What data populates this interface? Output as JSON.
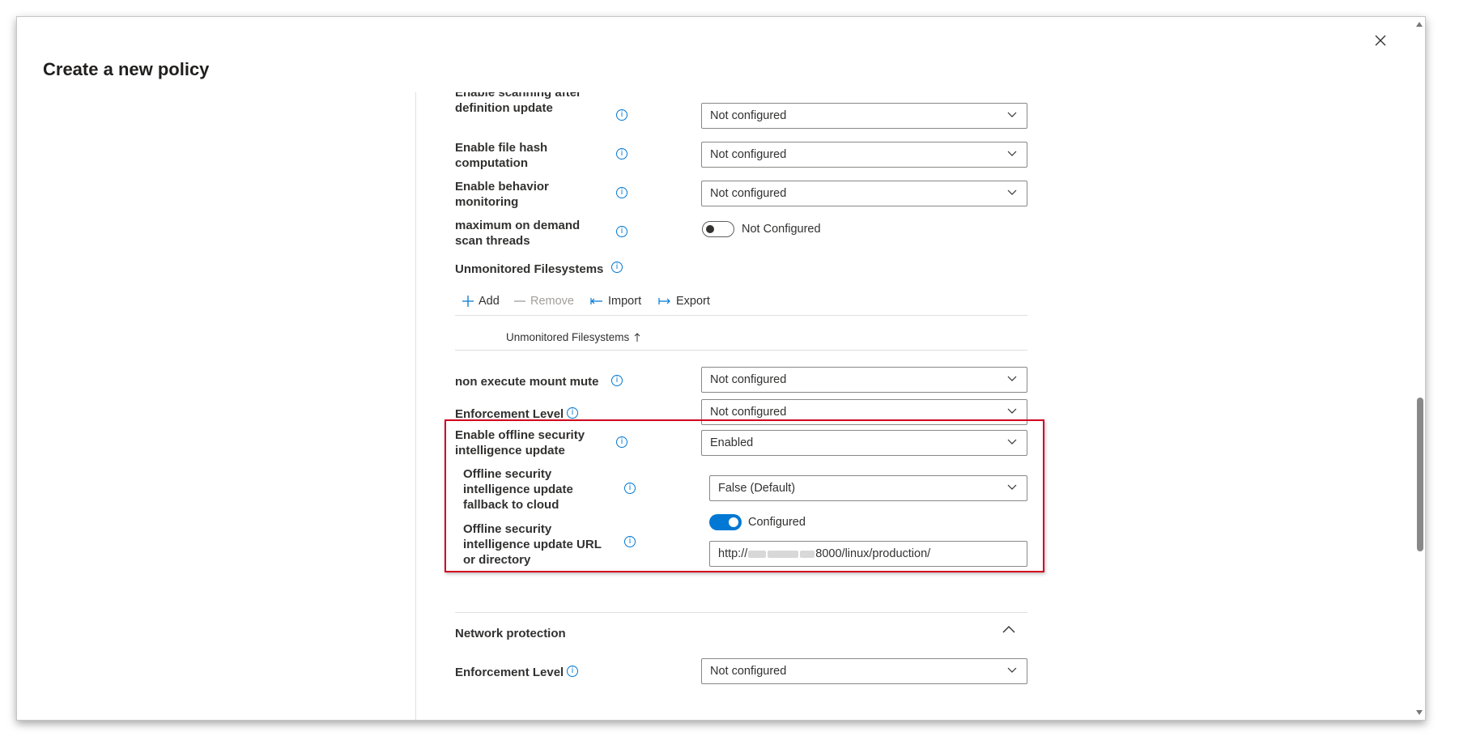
{
  "dialog": {
    "title": "Create a new policy"
  },
  "settings": {
    "scan_after_update": {
      "label": "Enable scanning after definition update",
      "value": "Not configured"
    },
    "file_hash": {
      "label": "Enable file hash computation",
      "value": "Not configured"
    },
    "behavior_monitoring": {
      "label": "Enable behavior monitoring",
      "value": "Not configured"
    },
    "max_threads": {
      "label": "maximum on demand scan threads",
      "toggle_label": "Not Configured",
      "toggle_on": false
    },
    "unmonitored": {
      "label": "Unmonitored Filesystems",
      "commands": {
        "add": "Add",
        "remove": "Remove",
        "import": "Import",
        "export": "Export"
      },
      "column_header": "Unmonitored Filesystems",
      "sort_icon": "arrow-up-icon"
    },
    "non_exec_mount": {
      "label": "non execute mount mute",
      "value": "Not configured"
    },
    "enforcement": {
      "label": "Enforcement Level",
      "value": "Not configured"
    },
    "offline_update": {
      "label": "Enable offline security intelligence update",
      "value": "Enabled"
    },
    "offline_fallback": {
      "label": "Offline security intelligence update fallback to cloud",
      "value": "False (Default)"
    },
    "offline_url": {
      "label": "Offline security intelligence update URL or directory",
      "toggle_label": "Configured",
      "toggle_on": true,
      "value_prefix": "http://",
      "value_suffix": "8000/linux/production/"
    }
  },
  "network_protection": {
    "section_title": "Network protection",
    "enforcement": {
      "label": "Enforcement Level",
      "value": "Not configured"
    }
  },
  "colors": {
    "accent": "#0078d4",
    "highlight_border": "#d1001f"
  }
}
